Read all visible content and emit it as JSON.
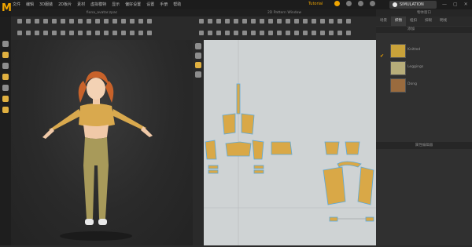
{
  "menu": [
    "文件",
    "编辑",
    "3D服装",
    "2D板片",
    "素材",
    "虚拟模特",
    "显示",
    "偏好设置",
    "设置",
    "手册",
    "帮助"
  ],
  "status": "Tutorial",
  "simulation_label": "SIMULATION",
  "window_buttons": [
    "—",
    "▢",
    "✕"
  ],
  "window3d_title": "fiona_avatar.zpac",
  "window2d_title": "2D Pattern Window",
  "right_panel": {
    "title": "物体窗口",
    "tabs": [
      "场景",
      "织物",
      "纽扣",
      "扣眼",
      "明线"
    ],
    "active_tab": 1,
    "section_label": "添加",
    "fabrics": [
      {
        "name": "Knitted",
        "color": "#c9a23a"
      },
      {
        "name": "Leggings",
        "color": "#b7ad7a"
      },
      {
        "name": "Dong",
        "color": "#9a6b3e"
      }
    ],
    "property_title": "属性编辑器"
  },
  "colors": {
    "accent": "#f0a500",
    "top_fabric": "#d9a94e",
    "legging_fabric": "#a89a5a",
    "pattern_fill": "#d9a847",
    "pattern_outline": "#5ca8d8"
  },
  "icons": [
    "logo",
    "gear-icon",
    "user-icon",
    "settings-icon",
    "help-icon"
  ]
}
